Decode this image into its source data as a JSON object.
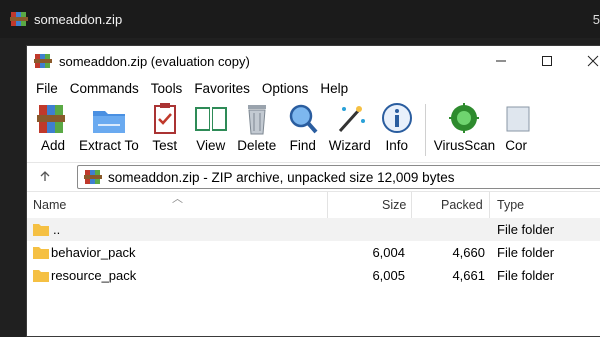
{
  "outer": {
    "tab_title": "someaddon.zip",
    "right_fragment": "5"
  },
  "window": {
    "title": "someaddon.zip (evaluation copy)",
    "controls": [
      "minimize",
      "maximize",
      "close"
    ]
  },
  "menu": [
    "File",
    "Commands",
    "Tools",
    "Favorites",
    "Options",
    "Help"
  ],
  "toolbar": [
    {
      "label": "Add",
      "icon": "add-books-icon"
    },
    {
      "label": "Extract To",
      "icon": "extract-folder-icon"
    },
    {
      "label": "Test",
      "icon": "test-clipboard-icon"
    },
    {
      "label": "View",
      "icon": "view-book-icon"
    },
    {
      "label": "Delete",
      "icon": "trash-icon"
    },
    {
      "label": "Find",
      "icon": "magnifier-icon"
    },
    {
      "label": "Wizard",
      "icon": "wand-icon"
    },
    {
      "label": "Info",
      "icon": "info-icon"
    },
    {
      "label": "VirusScan",
      "icon": "virus-icon"
    },
    {
      "label": "Cor",
      "icon": "comment-icon"
    }
  ],
  "address": {
    "text": "someaddon.zip - ZIP archive, unpacked size 12,009 bytes"
  },
  "columns": {
    "name": "Name",
    "size": "Size",
    "packed": "Packed",
    "type": "Type"
  },
  "rows": [
    {
      "name": "..",
      "size": "",
      "packed": "",
      "type": "File folder"
    },
    {
      "name": "behavior_pack",
      "size": "6,004",
      "packed": "4,660",
      "type": "File folder"
    },
    {
      "name": "resource_pack",
      "size": "6,005",
      "packed": "4,661",
      "type": "File folder"
    }
  ],
  "colors": {
    "folder": "#f5c043",
    "accent_blue": "#1f6fd6"
  }
}
